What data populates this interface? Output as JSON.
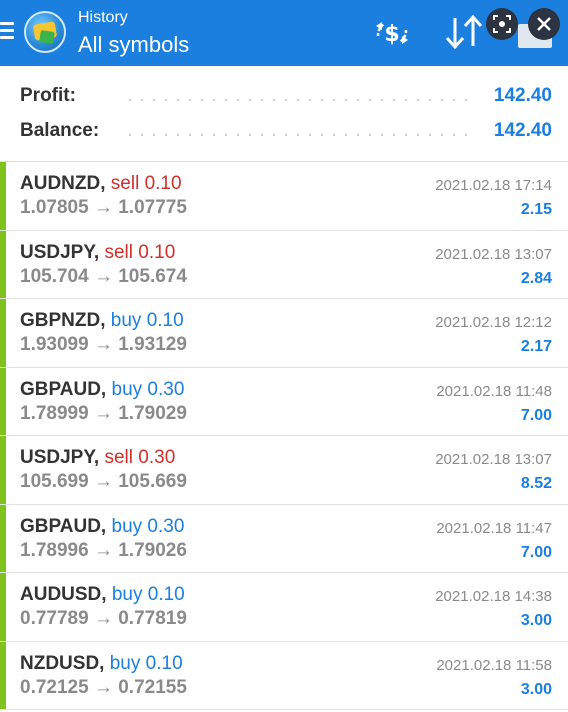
{
  "header": {
    "subtitle": "History",
    "title": "All symbols",
    "icons": [
      "menu-icon",
      "app-logo",
      "currency-switch-icon",
      "sort-icon",
      "lens-icon",
      "close-icon"
    ],
    "accent": "#1b7fe0"
  },
  "summary": {
    "profit_label": "Profit:",
    "profit_value": "142.40",
    "balance_label": "Balance:",
    "balance_value": "142.40"
  },
  "colors": {
    "sell": "#d0302b",
    "buy": "#1b7fe0",
    "profit_bar": "#7fc31c"
  },
  "trades": [
    {
      "symbol": "AUDNZD,",
      "side": "sell",
      "volume": "0.10",
      "prices": "1.07805 → 1.07775",
      "time": "2021.02.18 17:14",
      "profit": "2.15"
    },
    {
      "symbol": "USDJPY,",
      "side": "sell",
      "volume": "0.10",
      "prices": "105.704 → 105.674",
      "time": "2021.02.18 13:07",
      "profit": "2.84"
    },
    {
      "symbol": "GBPNZD,",
      "side": "buy",
      "volume": "0.10",
      "prices": "1.93099 → 1.93129",
      "time": "2021.02.18 12:12",
      "profit": "2.17"
    },
    {
      "symbol": "GBPAUD,",
      "side": "buy",
      "volume": "0.30",
      "prices": "1.78999 → 1.79029",
      "time": "2021.02.18 11:48",
      "profit": "7.00"
    },
    {
      "symbol": "USDJPY,",
      "side": "sell",
      "volume": "0.30",
      "prices": "105.699 → 105.669",
      "time": "2021.02.18 13:07",
      "profit": "8.52"
    },
    {
      "symbol": "GBPAUD,",
      "side": "buy",
      "volume": "0.30",
      "prices": "1.78996 → 1.79026",
      "time": "2021.02.18 11:47",
      "profit": "7.00"
    },
    {
      "symbol": "AUDUSD,",
      "side": "buy",
      "volume": "0.10",
      "prices": "0.77789 → 0.77819",
      "time": "2021.02.18 14:38",
      "profit": "3.00"
    },
    {
      "symbol": "NZDUSD,",
      "side": "buy",
      "volume": "0.10",
      "prices": "0.72125 → 0.72155",
      "time": "2021.02.18 11:58",
      "profit": "3.00"
    }
  ]
}
